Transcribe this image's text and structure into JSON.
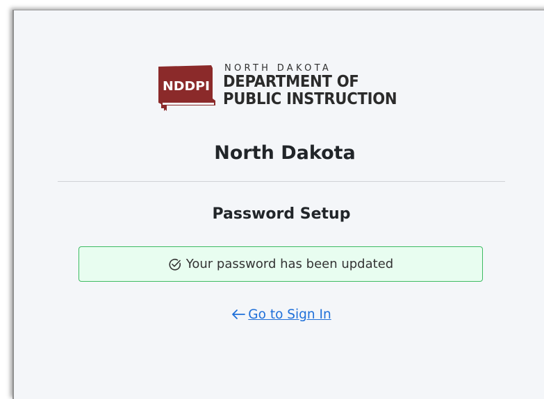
{
  "logo": {
    "abbrev": "NDDPI",
    "line1": "NORTH DAKOTA",
    "line2": "DEPARTMENT OF",
    "line3": "PUBLIC INSTRUCTION",
    "brand_color": "#8b2a2a"
  },
  "org_title": "North Dakota",
  "page_subtitle": "Password Setup",
  "alert": {
    "message": "Your password has been updated",
    "icon": "check-circle-icon",
    "bg_color": "#e8fdf0",
    "border_color": "#3dbb62"
  },
  "sign_in_link": {
    "label": "Go to Sign In",
    "icon": "arrow-left-icon",
    "color": "#1e6fd9"
  }
}
